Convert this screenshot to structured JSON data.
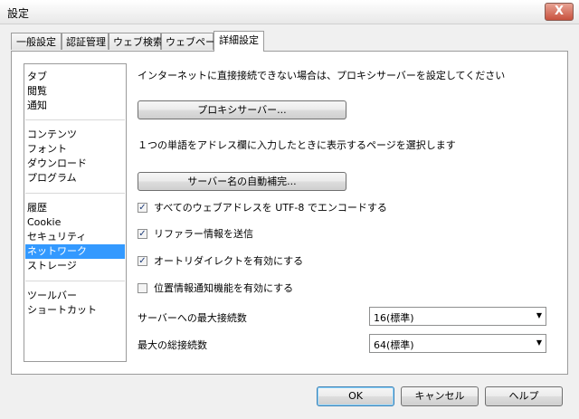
{
  "window": {
    "title": "設定",
    "close_glyph": "X"
  },
  "tabs": [
    {
      "label": "一般設定"
    },
    {
      "label": "認証管理"
    },
    {
      "label": "ウェブ検索"
    },
    {
      "label": "ウェブページ"
    },
    {
      "label": "詳細設定",
      "active": true
    }
  ],
  "sidebar": {
    "items": [
      {
        "label": "タブ"
      },
      {
        "label": "閲覧"
      },
      {
        "label": "通知"
      },
      {
        "label": "コンテンツ"
      },
      {
        "label": "フォント"
      },
      {
        "label": "ダウンロード"
      },
      {
        "label": "プログラム"
      },
      {
        "label": "履歴"
      },
      {
        "label": "Cookie"
      },
      {
        "label": "セキュリティ"
      },
      {
        "label": "ネットワーク",
        "selected": true
      },
      {
        "label": "ストレージ"
      },
      {
        "label": "ツールバー"
      },
      {
        "label": "ショートカット"
      }
    ],
    "selected_color": "#3399ff"
  },
  "network": {
    "proxy_description": "インターネットに直接接続できない場合は、プロキシサーバーを設定してください",
    "proxy_button": "プロキシサーバー...",
    "autocomplete_description": "１つの単語をアドレス欄に入力したときに表示するページを選択します",
    "autocomplete_button": "サーバー名の自動補完...",
    "checkboxes": [
      {
        "label": "すべてのウェブアドレスを UTF-8 でエンコードする",
        "checked": true,
        "mark": "✓"
      },
      {
        "label": "リファラー情報を送信",
        "checked": true,
        "mark": "✓"
      },
      {
        "label": "オートリダイレクトを有効にする",
        "checked": true,
        "mark": "✓"
      },
      {
        "label": "位置情報通知機能を有効にする",
        "checked": false,
        "mark": ""
      }
    ],
    "max_connections_per_server": {
      "label": "サーバーへの最大接続数",
      "value": "16(標準)"
    },
    "max_connections_total": {
      "label": "最大の総接続数",
      "value": "64(標準)"
    },
    "dropdown_glyph": "▼"
  },
  "footer": {
    "ok": "OK",
    "cancel": "キャンセル",
    "help": "ヘルプ"
  }
}
